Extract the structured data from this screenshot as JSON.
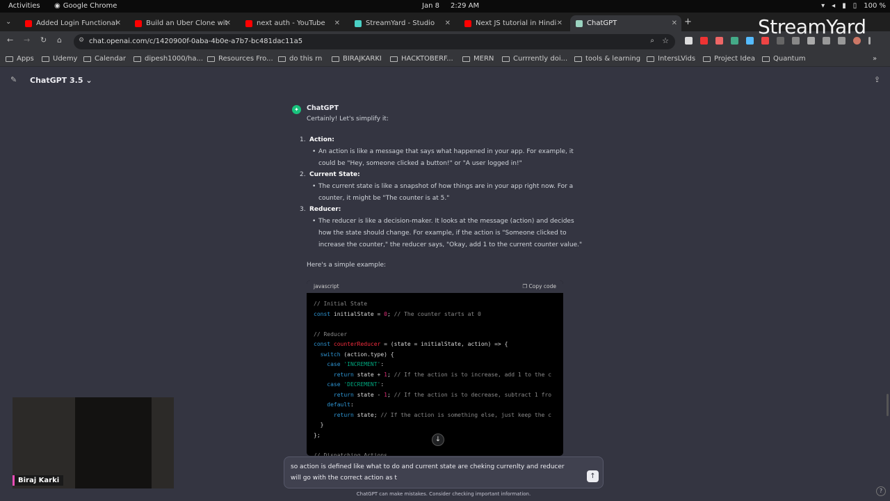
{
  "system": {
    "activities": "Activities",
    "app": "Google Chrome",
    "date": "Jan 8",
    "time": "2:29 AM",
    "battery": "100 %"
  },
  "tabs": [
    {
      "label": "Added Login Functional",
      "color": "#ff0000"
    },
    {
      "label": "Build an Uber Clone wit",
      "color": "#ff0000"
    },
    {
      "label": "next auth - YouTube",
      "color": "#ff0000"
    },
    {
      "label": "StreamYard - Studio",
      "color": "#4ad0c5"
    },
    {
      "label": "Next JS tutorial in Hindi",
      "color": "#ff0000"
    },
    {
      "label": "ChatGPT",
      "color": "#9bd3c0"
    }
  ],
  "url": "chat.openai.com/c/1420900f-0aba-4b0e-a7b7-bc481dac11a5",
  "bookmarks": [
    "Apps",
    "Udemy",
    "Calendar",
    "dipesh1000/ha...",
    "Resources Fro...",
    "do this rn",
    "BIRAJKARKI",
    "HACKTOBERF...",
    "MERN",
    "Currrently doi...",
    "tools & learning",
    "IntersLVids",
    "Project Idea",
    "Quantum"
  ],
  "header": {
    "title": "ChatGPT 3.5 ⌄"
  },
  "message": {
    "author": "ChatGPT",
    "intro": "Certainly! Let's simplify it:",
    "items": [
      {
        "num": "1.",
        "head": "Action:",
        "lines": [
          "An action is like a message that says what happened in your app. For example, it",
          "could be \"Hey, someone clicked a button!\" or \"A user logged in!\""
        ]
      },
      {
        "num": "2.",
        "head": "Current State:",
        "lines": [
          "The current state is like a snapshot of how things are in your app right now. For a",
          "counter, it might be \"The counter is at 5.\""
        ]
      },
      {
        "num": "3.",
        "head": "Reducer:",
        "lines": [
          "The reducer is like a decision-maker. It looks at the message (action) and decides",
          "how the state should change. For example, if the action is \"Someone clicked to",
          "increase the counter,\" the reducer says, \"Okay, add 1 to the current counter value.\""
        ]
      }
    ],
    "example": "Here's a simple example:",
    "code_lang": "javascript",
    "copy_label": "Copy code"
  },
  "input": {
    "value": "so action is defined like what to do and current state are cheking currenlty and reducer will go with the correct action as t"
  },
  "disclaimer": "ChatGPT can make mistakes. Consider checking important information.",
  "camera": {
    "name": "Biraj Karki"
  },
  "watermark": "StreamYard"
}
